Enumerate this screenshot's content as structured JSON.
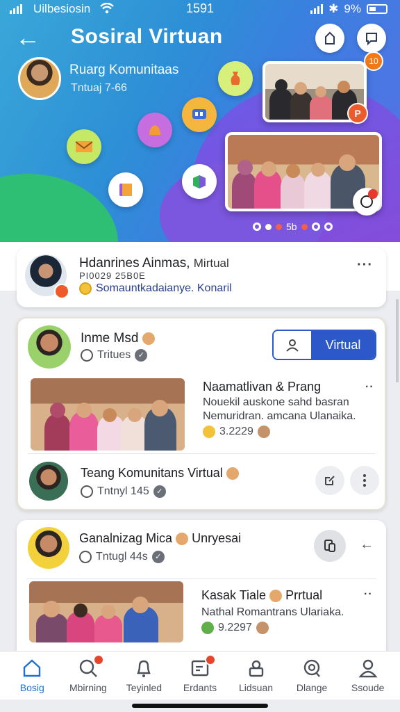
{
  "status_bar": {
    "carrier": "Uilbesiosin",
    "time": "1591",
    "battery": "9%"
  },
  "header": {
    "title": "Sosiral Virtuan",
    "notification_count": "10",
    "community": {
      "name": "Ruarg Komunitaas",
      "sub": "Tntuaj 7-66"
    },
    "photo_badge": "P",
    "pager_label": "5b"
  },
  "colors": {
    "primary": "#2c58c9",
    "accent": "#ef5a2a",
    "active_nav": "#1f6fd6"
  },
  "feed": {
    "pinned": {
      "name": "Hdanrines Ainmas,",
      "name_suffix": "Mirtual",
      "id": "PI0029 25B0E",
      "link": "Somauntkadaianye. Konaril"
    },
    "group1": {
      "name": "Inme Msd",
      "sub": "Tritues",
      "follow_label": "Virtual",
      "post": {
        "title": "Naamatlivan & Prang",
        "line1": "Nouekil auskone sahd basran",
        "line2": "Nemuridran. amcana Ulanaika.",
        "stat": "3.2229"
      },
      "item2": {
        "name": "Teang Komunitans Virtual",
        "sub": "Tntnyl 145"
      }
    },
    "group2": {
      "name": "Ganalnizag Mica",
      "name_suffix": "Unryesai",
      "sub": "Tntugl 44s",
      "post": {
        "title": "Kasak Tiale",
        "title_suffix": "Prrtual",
        "line1": "Nathal Romantrans Ulariaka.",
        "stat": "9.2297"
      }
    }
  },
  "bottom_nav": [
    {
      "label": "Bosig",
      "icon": "home-icon",
      "active": true
    },
    {
      "label": "Mbirning",
      "icon": "search-icon",
      "active": false,
      "badge": true
    },
    {
      "label": "Teyinled",
      "icon": "bell-icon",
      "active": false
    },
    {
      "label": "Erdants",
      "icon": "calendar-icon",
      "active": false,
      "badge": true
    },
    {
      "label": "Lidsuan",
      "icon": "lock-icon",
      "active": false
    },
    {
      "label": "Dlange",
      "icon": "discover-icon",
      "active": false
    },
    {
      "label": "Ssoude",
      "icon": "profile-icon",
      "active": false
    }
  ]
}
